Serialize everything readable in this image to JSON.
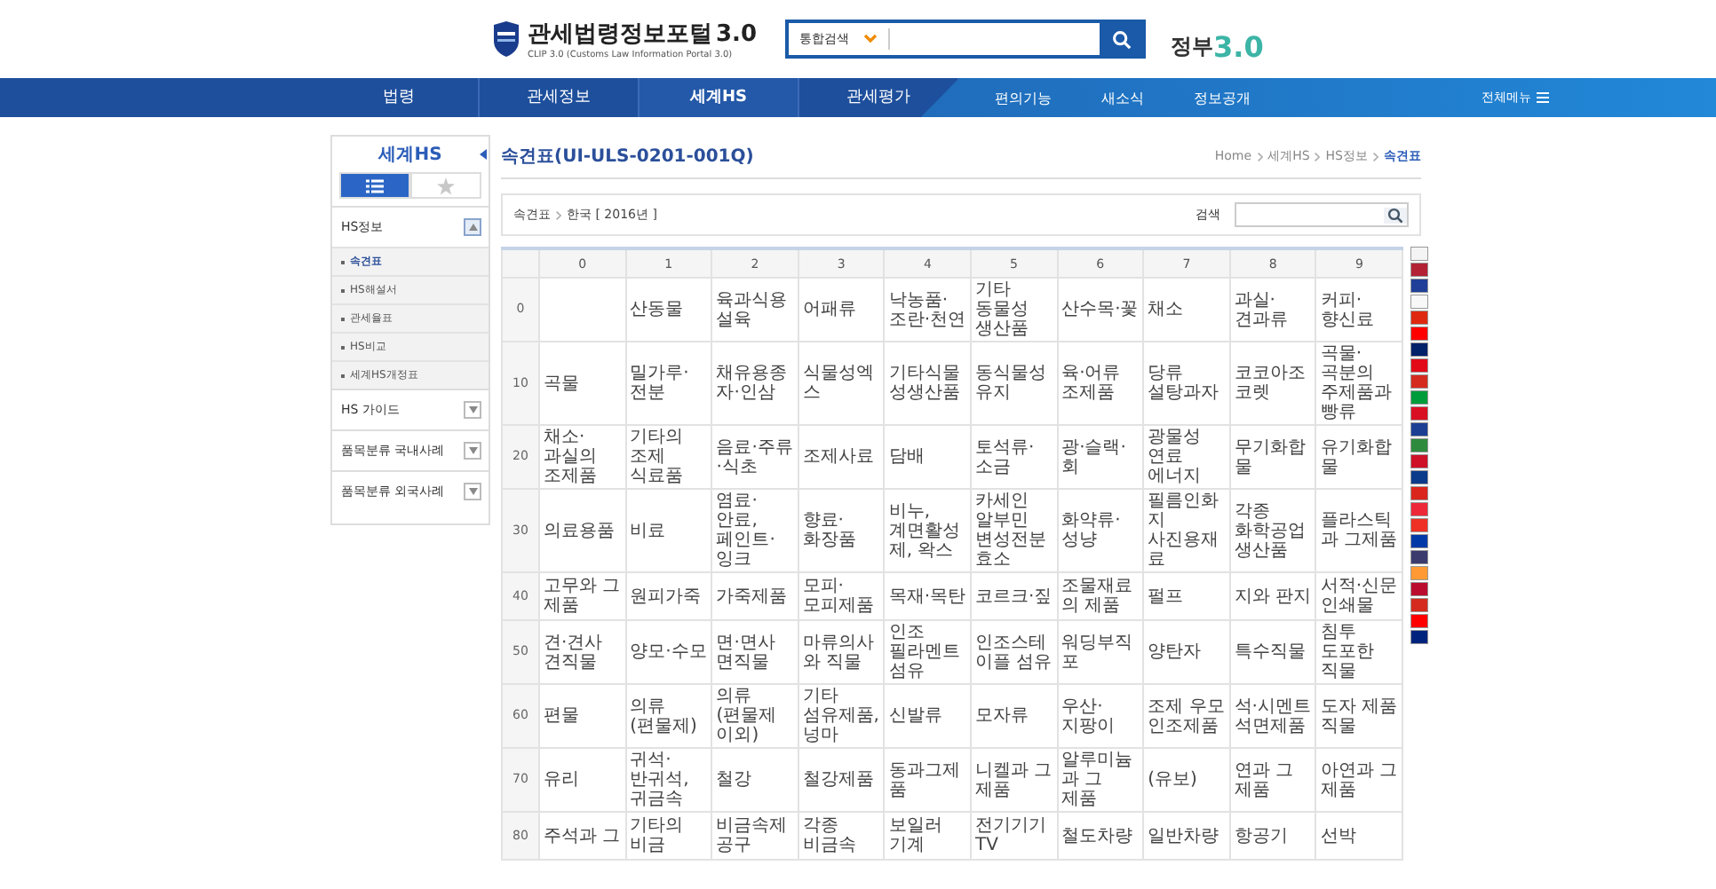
{
  "header": {
    "logo_title": "관세법령정보포털",
    "logo_version": "3.0",
    "logo_subtitle": "CLIP 3.0 (Customs Law Information Portal 3.0)",
    "search_scope": "통합검색",
    "gov_logo_text": "정부",
    "gov_logo_version": "3.0"
  },
  "nav": {
    "primary": [
      {
        "label": "법령",
        "selected": false
      },
      {
        "label": "관세정보",
        "selected": false
      },
      {
        "label": "세계HS",
        "selected": true
      },
      {
        "label": "관세평가",
        "selected": false
      }
    ],
    "secondary": [
      "편의기능",
      "새소식",
      "정보공개"
    ],
    "all_menu": "전체메뉴"
  },
  "sidebar": {
    "title": "세계HS",
    "tabs": [
      {
        "kind": "list",
        "selected": true
      },
      {
        "kind": "star",
        "selected": false
      }
    ],
    "sections": [
      {
        "label": "HS정보",
        "expanded": true,
        "children": [
          {
            "label": "속견표",
            "selected": true
          },
          {
            "label": "HS해설서",
            "selected": false
          },
          {
            "label": "관세율표",
            "selected": false
          },
          {
            "label": "HS비교",
            "selected": false
          },
          {
            "label": "세계HS개정표",
            "selected": false
          }
        ]
      },
      {
        "label": "HS 가이드",
        "expanded": false
      },
      {
        "label": "품목분류 국내사례",
        "expanded": false
      },
      {
        "label": "품목분류 외국사례",
        "expanded": false
      }
    ]
  },
  "main": {
    "title": "속견표(UI-ULS-0201-001Q)",
    "breadcrumb": [
      {
        "label": "Home",
        "selected": false
      },
      {
        "label": "세계HS",
        "selected": false
      },
      {
        "label": "HS정보",
        "selected": false
      },
      {
        "label": "속견표",
        "selected": true
      }
    ],
    "filter_path": [
      "속견표",
      "한국 [ 2016년 ]"
    ],
    "search_label": "검색"
  },
  "table": {
    "columns": [
      "0",
      "1",
      "2",
      "3",
      "4",
      "5",
      "6",
      "7",
      "8",
      "9"
    ],
    "rows": [
      {
        "label": "0",
        "cells": [
          null,
          "산동물",
          "육과식용설육",
          "어패류",
          "낙농품·조란·천연",
          "기타 동물성 생산품",
          "산수목·꽃",
          "채소",
          "과실·견과류",
          "커피·향신료"
        ]
      },
      {
        "label": "10",
        "cells": [
          "곡물",
          "밀가루·전분",
          "채유용종자·인삼",
          "식물성엑스",
          "기타식물성생산품",
          "동식물성유지",
          "육·어류 조제품",
          "당류 설탕과자",
          "코코아조코렛",
          "곡물·곡분의 주제품과빵류"
        ]
      },
      {
        "label": "20",
        "cells": [
          "채소·과실의 조제품",
          "기타의 조제 식료품",
          "음료·주류·식초",
          "조제사료",
          "담배",
          "토석류·소금",
          "광·슬랙·회",
          "광물성 연료 에너지",
          "무기화합물",
          "유기화합물"
        ]
      },
      {
        "label": "30",
        "cells": [
          "의료용품",
          "비료",
          "염료·안료, 페인트·잉크",
          "향료·화장품",
          "비누, 계면활성제, 왁스",
          "카세인 알부민 변성전분 효소",
          "화약류·성냥",
          "필름인화지 사진용재료",
          "각종 화학공업 생산품",
          "플라스틱과 그제품"
        ]
      },
      {
        "label": "40",
        "cells": [
          "고무와 그 제품",
          "원피가죽",
          "가죽제품",
          "모피·모피제품",
          "목재·목탄",
          "코르크·짚",
          "조물재료의 제품",
          "펄프",
          "지와 판지",
          "서적·신문 인쇄물"
        ]
      },
      {
        "label": "50",
        "cells": [
          "견·견사 견직물",
          "양모·수모",
          "면·면사 면직물",
          "마류의사와 직물",
          "인조 필라멘트 섬유",
          "인조스테이플 섬유",
          "워딩부직포",
          "양탄자",
          "특수직물",
          "침투 도포한 직물"
        ]
      },
      {
        "label": "60",
        "cells": [
          "편물",
          "의류(편물제)",
          "의류(편물제이외)",
          "기타 섬유제품,넝마",
          "신발류",
          "모자류",
          "우산·지팡이",
          "조제 우모 인조제품",
          "석·시멘트 석면제품",
          "도자 제품 직물"
        ]
      },
      {
        "label": "70",
        "cells": [
          "유리",
          "귀석·반귀석,귀금속",
          "철강",
          "철강제품",
          "동과그제품",
          "니켈과 그 제품",
          "알루미늄과 그 제품",
          "(유보)",
          "연과 그 제품",
          "아연과 그 제품"
        ]
      },
      {
        "label": "80",
        "cells": [
          "주석과 그",
          "기타의 비금",
          "비금속제공구",
          "각종 비금속",
          "보일러 기계",
          "전기기기TV",
          "철도차량",
          "일반차량",
          "항공기",
          "선박"
        ]
      }
    ]
  },
  "flags": [
    {
      "color": "#f4f4f4"
    },
    {
      "color": "#b22234"
    },
    {
      "color": "#1f3f99"
    },
    {
      "color": "#f8f8f8"
    },
    {
      "color": "#de2910"
    },
    {
      "color": "#fe0000"
    },
    {
      "color": "#012169"
    },
    {
      "color": "#e30a17"
    },
    {
      "color": "#d52b1e"
    },
    {
      "color": "#009c3b"
    },
    {
      "color": "#d91023"
    },
    {
      "color": "#1c3f94"
    },
    {
      "color": "#2e8b3d"
    },
    {
      "color": "#ce1126"
    },
    {
      "color": "#0a3a8a"
    },
    {
      "color": "#da251d"
    },
    {
      "color": "#ed2939"
    },
    {
      "color": "#ee3124"
    },
    {
      "color": "#0038a8"
    },
    {
      "color": "#3c3b6e"
    },
    {
      "color": "#ff9933"
    },
    {
      "color": "#ba0c2f"
    },
    {
      "color": "#d52b1e"
    },
    {
      "color": "#ff0000"
    },
    {
      "color": "#00247d"
    }
  ]
}
